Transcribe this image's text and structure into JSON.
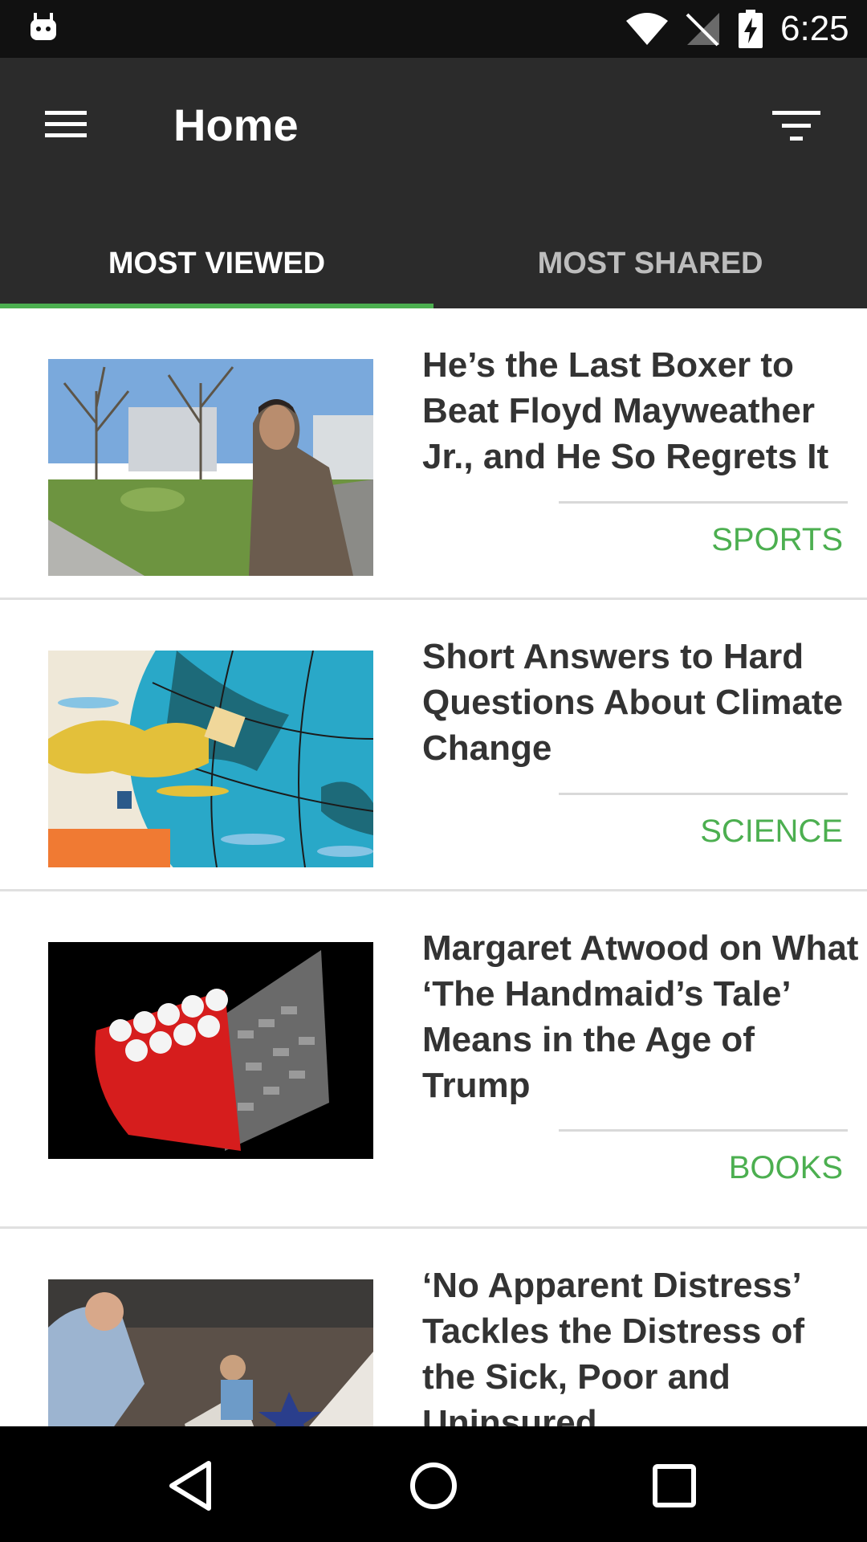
{
  "status_bar": {
    "time": "6:25",
    "icons": [
      "android-icon",
      "wifi-icon",
      "no-signal-icon",
      "battery-charging-icon"
    ]
  },
  "app_bar": {
    "title": "Home",
    "menu_icon": "hamburger-menu-icon",
    "filter_icon": "filter-icon"
  },
  "tabs": [
    {
      "label": "MOST VIEWED",
      "active": true
    },
    {
      "label": "MOST SHARED",
      "active": false
    }
  ],
  "accent_color": "#4caf50",
  "articles": [
    {
      "headline": "He’s the Last Boxer to Beat Floyd Mayweather Jr., and He So Regrets It",
      "category": "SPORTS"
    },
    {
      "headline": "Short Answers to Hard Questions About Climate Change",
      "category": "SCIENCE"
    },
    {
      "headline": "Margaret Atwood on What ‘The Handmaid’s Tale’ Means in the Age of Trump",
      "category": "BOOKS"
    },
    {
      "headline": "‘No Apparent Distress’ Tackles the Distress of the Sick, Poor and Uninsured",
      "category": ""
    }
  ],
  "nav_bar": {
    "icons": [
      "back-icon",
      "home-icon",
      "recents-icon"
    ]
  }
}
